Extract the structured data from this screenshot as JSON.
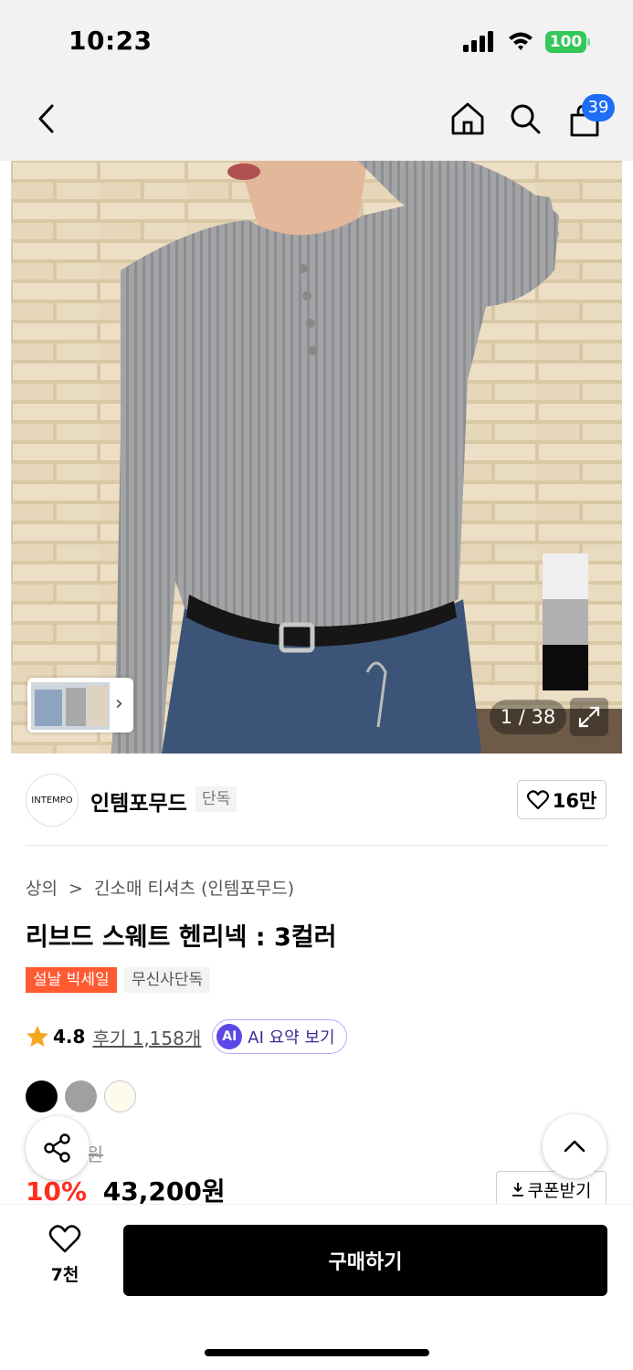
{
  "status_bar": {
    "time": "10:23",
    "battery": "100"
  },
  "nav": {
    "cart_count": "39"
  },
  "gallery": {
    "page_counter": "1 / 38",
    "thumb_chevron": "›"
  },
  "brand": {
    "logo_text": "INTEMPO",
    "name": "인템포무드",
    "tag": "단독",
    "like_count": "16만"
  },
  "product": {
    "breadcrumb": [
      "상의",
      ">",
      "긴소매 티셔츠 (인템포무드)"
    ],
    "title": "리브드 스웨트 헨리넥 : 3컬러",
    "badges": {
      "sale": "설날 빅세일",
      "exclusive": "무신사단독"
    },
    "rating": "4.8",
    "reviews": "후기 1,158개",
    "ai_label": "AI",
    "ai_summary": "AI 요약 보기",
    "swatches": [
      {
        "name": "black",
        "color": "#000000"
      },
      {
        "name": "gray",
        "color": "#a0a0a0"
      },
      {
        "name": "ivory",
        "color": "#fdfbec"
      }
    ],
    "original_price_partial": "0원",
    "discount": "10%",
    "price": "43,200원",
    "coupon_label": "쿠폰받기"
  },
  "bottom": {
    "wish_count": "7천",
    "buy_label": "구매하기"
  },
  "colors": {
    "accent_blue": "#1d6ef5",
    "sale_orange": "#ff5a32",
    "discount_red": "#ff2d20",
    "ai_purple": "#5b48e6",
    "battery_green": "#34c759"
  }
}
